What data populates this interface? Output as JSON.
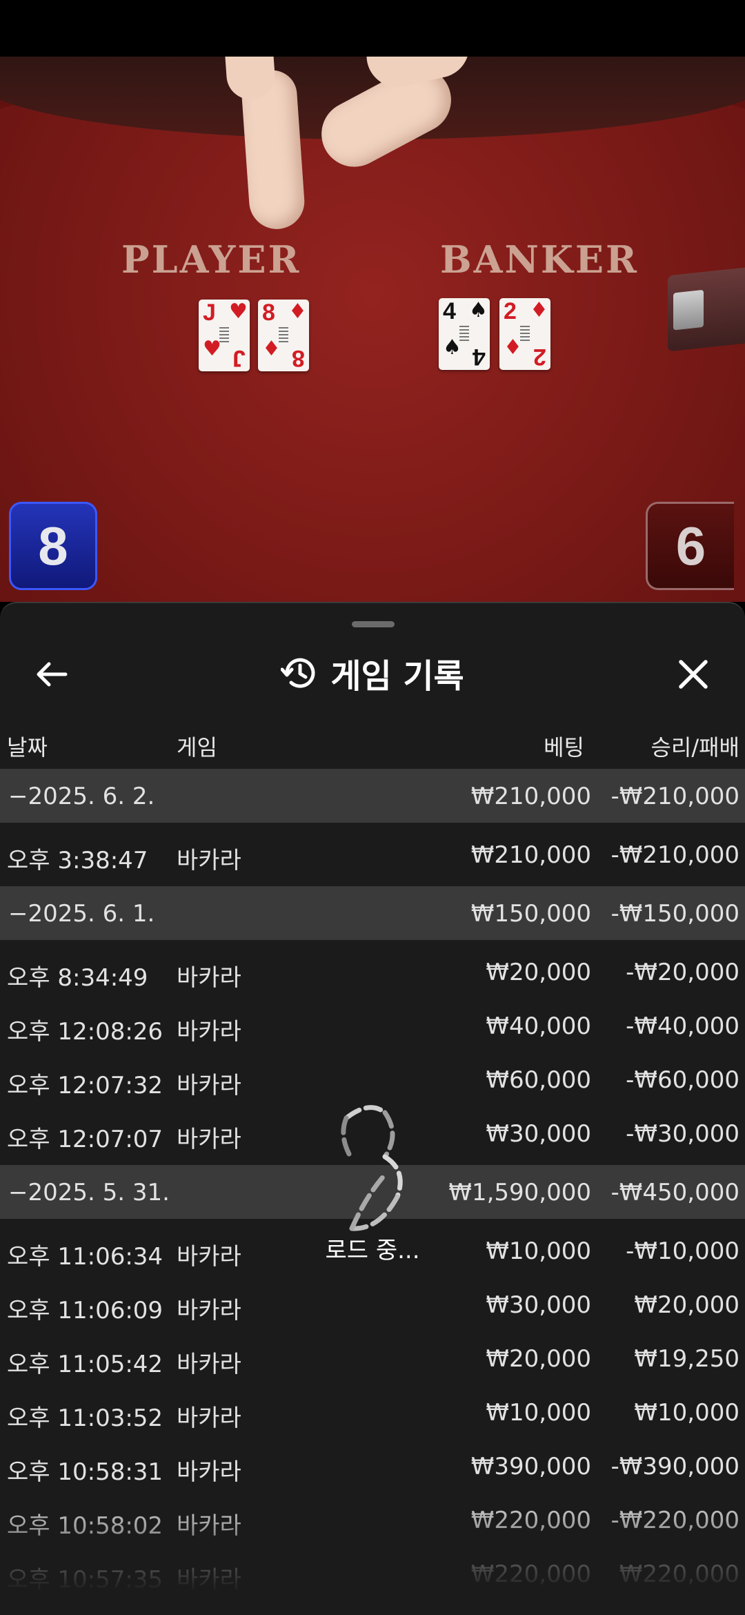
{
  "video": {
    "player_label": "PLAYER",
    "banker_label": "BANKER",
    "player_cards": [
      {
        "rank": "J",
        "suit": "♥",
        "color": "red"
      },
      {
        "rank": "8",
        "suit": "♦",
        "color": "red"
      }
    ],
    "banker_cards": [
      {
        "rank": "4",
        "suit": "♠",
        "color": "black"
      },
      {
        "rank": "2",
        "suit": "♦",
        "color": "red"
      }
    ],
    "player_score": "8",
    "banker_score": "6"
  },
  "sheet": {
    "title": "게임 기록",
    "icons": {
      "back": "arrow-left-icon",
      "history": "history-icon",
      "close": "close-icon"
    },
    "columns": {
      "date": "날짜",
      "game": "게임",
      "bet": "베팅",
      "win": "승리/패배"
    },
    "rows": [
      {
        "type": "group",
        "date": "−2025. 6. 2.",
        "bet": "₩210,000",
        "win": "-₩210,000"
      },
      {
        "type": "item",
        "date": "오후 3:38:47",
        "game": "바카라",
        "bet": "₩210,000",
        "win": "-₩210,000"
      },
      {
        "type": "group",
        "date": "−2025. 6. 1.",
        "bet": "₩150,000",
        "win": "-₩150,000"
      },
      {
        "type": "item",
        "date": "오후 8:34:49",
        "game": "바카라",
        "bet": "₩20,000",
        "win": "-₩20,000"
      },
      {
        "type": "item",
        "date": "오후 12:08:26",
        "game": "바카라",
        "bet": "₩40,000",
        "win": "-₩40,000"
      },
      {
        "type": "item",
        "date": "오후 12:07:32",
        "game": "바카라",
        "bet": "₩60,000",
        "win": "-₩60,000"
      },
      {
        "type": "item",
        "date": "오후 12:07:07",
        "game": "바카라",
        "bet": "₩30,000",
        "win": "-₩30,000"
      },
      {
        "type": "group",
        "date": "−2025. 5. 31.",
        "bet": "₩1,590,000",
        "win": "-₩450,000"
      },
      {
        "type": "item",
        "date": "오후 11:06:34",
        "game": "바카라",
        "bet": "₩10,000",
        "win": "-₩10,000"
      },
      {
        "type": "item",
        "date": "오후 11:06:09",
        "game": "바카라",
        "bet": "₩30,000",
        "win": "₩20,000"
      },
      {
        "type": "item",
        "date": "오후 11:05:42",
        "game": "바카라",
        "bet": "₩20,000",
        "win": "₩19,250"
      },
      {
        "type": "item",
        "date": "오후 11:03:52",
        "game": "바카라",
        "bet": "₩10,000",
        "win": "₩10,000"
      },
      {
        "type": "item",
        "date": "오후 10:58:31",
        "game": "바카라",
        "bet": "₩390,000",
        "win": "-₩390,000"
      },
      {
        "type": "item",
        "date": "오후 10:58:02",
        "game": "바카라",
        "bet": "₩220,000",
        "win": "-₩220,000"
      },
      {
        "type": "item",
        "date": "오후 10:57:35",
        "game": "바카라",
        "bet": "₩220,000",
        "win": "₩220,000"
      }
    ],
    "loading_text": "로드 중..."
  }
}
